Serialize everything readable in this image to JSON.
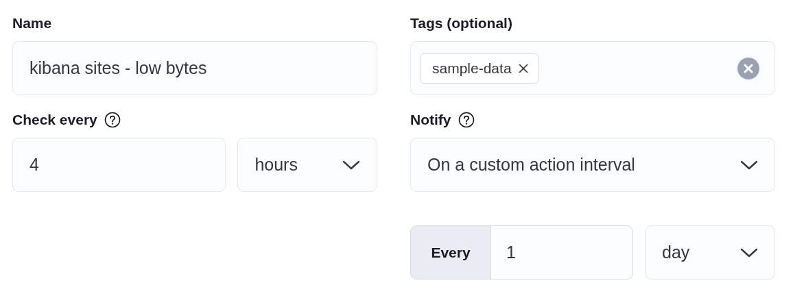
{
  "name": {
    "label": "Name",
    "value": "kibana sites - low bytes"
  },
  "tags": {
    "label": "Tags (optional)",
    "items": [
      {
        "label": "sample-data"
      }
    ]
  },
  "check_every": {
    "label": "Check every",
    "value": "4",
    "unit": "hours"
  },
  "notify": {
    "label": "Notify",
    "value": "On a custom action interval"
  },
  "interval": {
    "prepend": "Every",
    "value": "1",
    "unit": "day"
  }
}
